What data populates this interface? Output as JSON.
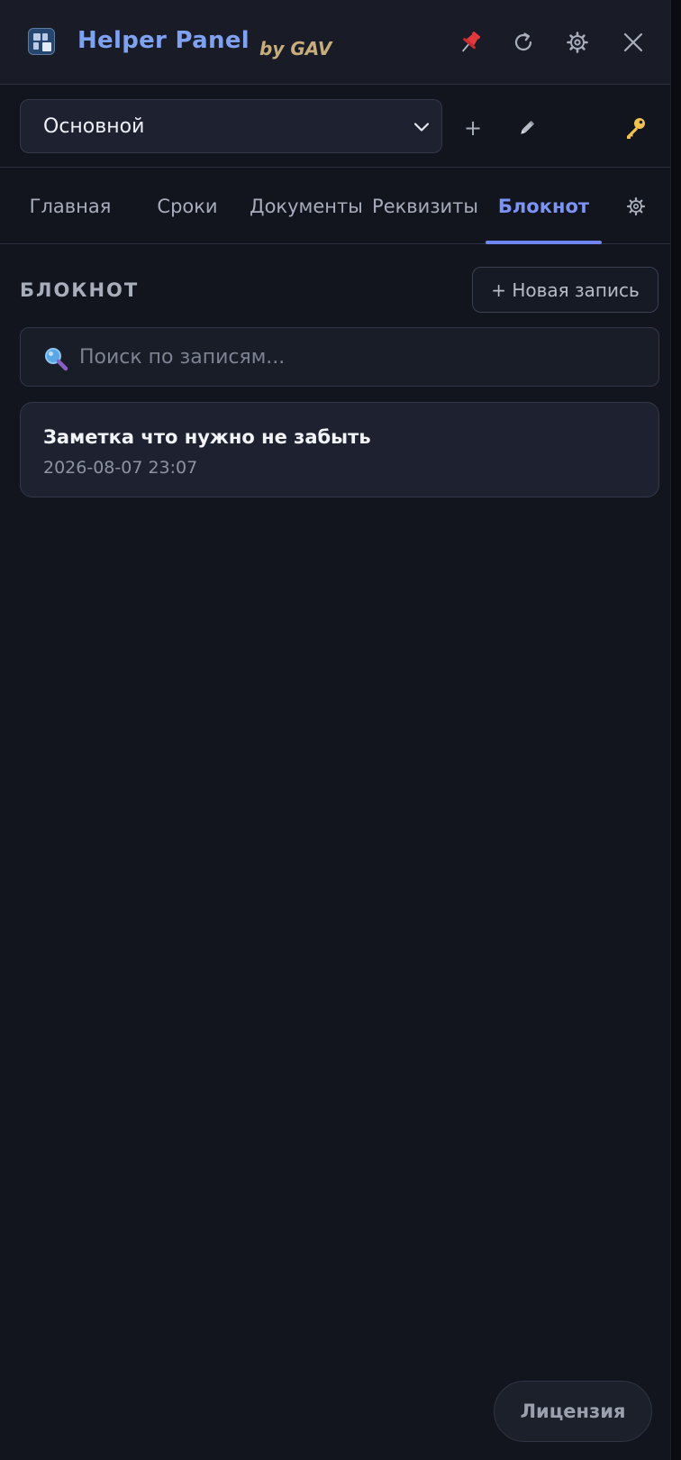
{
  "titlebar": {
    "title": "Helper Panel",
    "subtitle": "by GAV",
    "logo_icon": "app-logo-icon",
    "buttons": [
      {
        "name": "pin",
        "icon": "pushpin-icon",
        "color": "#e0393e"
      },
      {
        "name": "refresh",
        "icon": "refresh-icon"
      },
      {
        "name": "settings",
        "icon": "gear-icon"
      },
      {
        "name": "close",
        "icon": "close-icon"
      }
    ]
  },
  "profile": {
    "selected": "Основной",
    "add_label": "+",
    "edit_icon": "pencil-icon",
    "key_icon": "key-icon"
  },
  "tabs": [
    {
      "label": "Главная",
      "active": false
    },
    {
      "label": "Сроки",
      "active": false
    },
    {
      "label": "Документы",
      "active": false
    },
    {
      "label": "Реквизиты",
      "active": false
    },
    {
      "label": "Блокнот",
      "active": true
    }
  ],
  "tab_settings_icon": "gear-icon",
  "notebook": {
    "section_title": "БЛОКНОТ",
    "new_entry_label": "+ Новая запись",
    "search_placeholder": "Поиск по записям...",
    "search_icon": "magnifier-icon",
    "notes": [
      {
        "title": "Заметка что нужно не забыть",
        "date": "2026-08-07 23:07"
      }
    ]
  },
  "footer": {
    "license_label": "Лицензия"
  },
  "colors": {
    "background": "#12151d",
    "accent": "#6f86f2",
    "title_gradient": "#7ea1f2",
    "subtitle": "#c7ad7c",
    "key": "#f2c14e"
  }
}
